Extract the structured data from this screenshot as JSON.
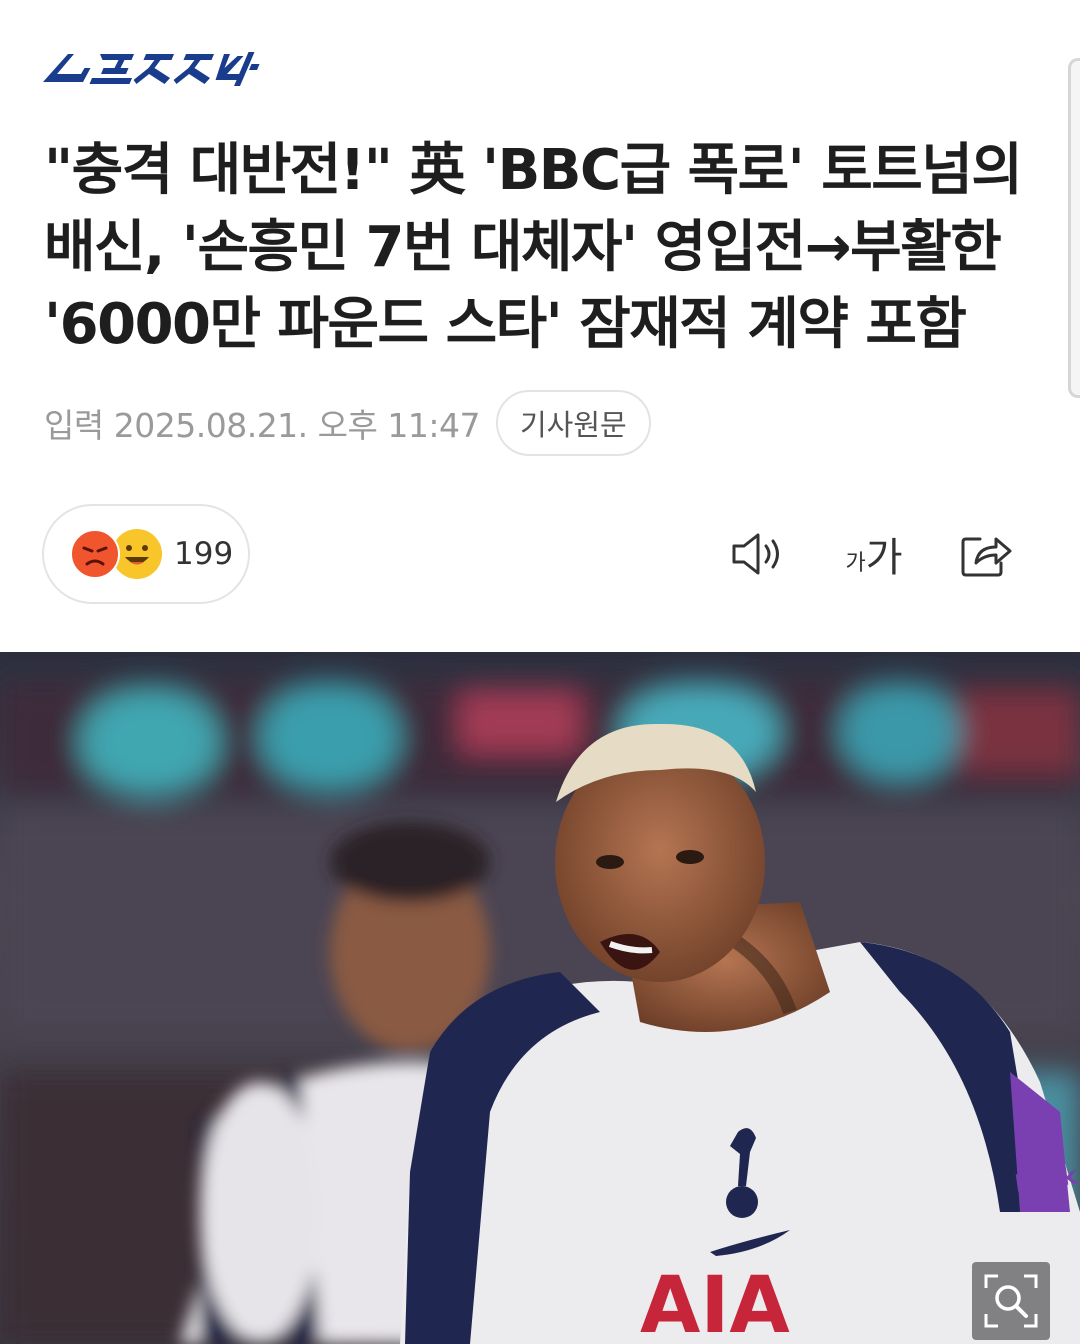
{
  "press": {
    "logo_text": "스포츠조선",
    "logo_color": "#1a3c8c",
    "logo_icon": "press-logo"
  },
  "article": {
    "headline_lines": [
      "\"충격 대반전!\" 英 'BBC급 폭로' 토트넘의",
      "배신, '손흥민 7번 대체자' 영입전→부활한",
      "'6000만 파운드 스타' 잠재적 계약 포함"
    ],
    "published_label": "입력",
    "published_date": "2025.08.21. 오후 11:47",
    "original_link_label": "기사원문"
  },
  "reactions": {
    "icons": [
      "angry-emoji-icon",
      "laughing-emoji-icon"
    ],
    "count": "199"
  },
  "toolbar": {
    "tts_icon": "speaker-icon",
    "font_size_small": "가",
    "font_size_big": "가",
    "share_icon": "share-icon"
  },
  "photo": {
    "description_icon": "article-photo",
    "zoom_icon": "zoom-icon"
  },
  "colors": {
    "headline": "#1e1e1e",
    "meta": "#9a9a9a",
    "accent_angry": "#f0552d",
    "accent_laugh": "#f8c52a"
  }
}
